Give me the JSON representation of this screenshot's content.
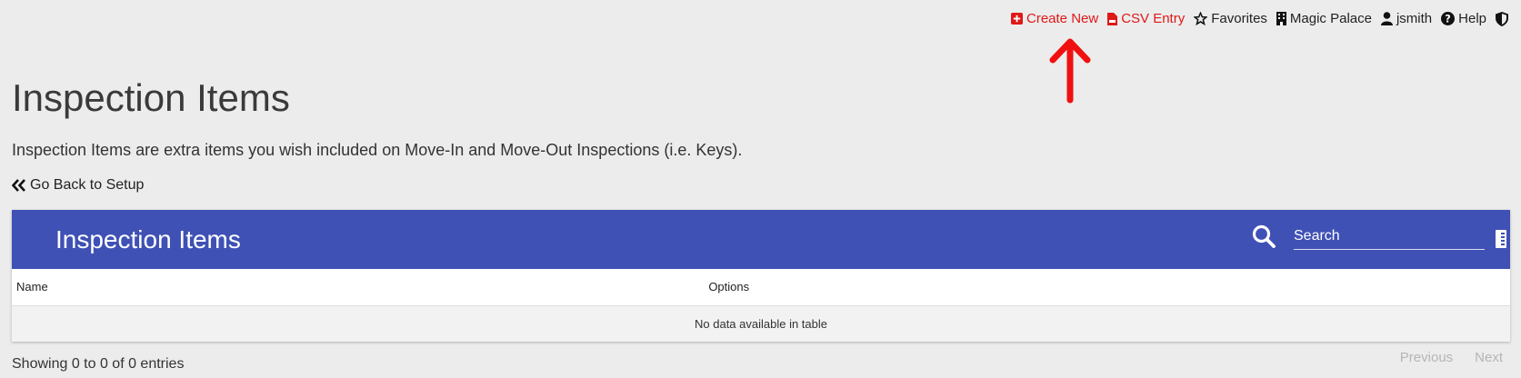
{
  "topnav": {
    "create_new": "Create New",
    "csv_entry": "CSV Entry",
    "favorites": "Favorites",
    "property": "Magic Palace",
    "user": "jsmith",
    "help": "Help"
  },
  "page": {
    "title": "Inspection Items",
    "description": "Inspection Items are extra items you wish included on Move-In and Move-Out Inspections (i.e. Keys).",
    "back_link": "Go Back to Setup"
  },
  "table_card": {
    "title": "Inspection Items",
    "search_placeholder": "Search",
    "columns": [
      "Name",
      "Options"
    ],
    "empty_message": "No data available in table"
  },
  "footer": {
    "info": "Showing 0 to 0 of 0 entries",
    "previous": "Previous",
    "next": "Next"
  },
  "colors": {
    "header_bg": "#3f51b5",
    "accent_red": "#e01818",
    "page_bg": "#ececec"
  },
  "icons": {
    "create_new": "plus-square-icon",
    "csv_entry": "csv-file-icon",
    "favorites": "star-icon",
    "property": "building-icon",
    "user": "user-icon",
    "help": "question-circle-icon",
    "shield": "shield-icon",
    "back": "double-chevron-left-icon",
    "search": "search-icon",
    "columns": "columns-icon",
    "annotation": "red-arrow-up-icon"
  }
}
